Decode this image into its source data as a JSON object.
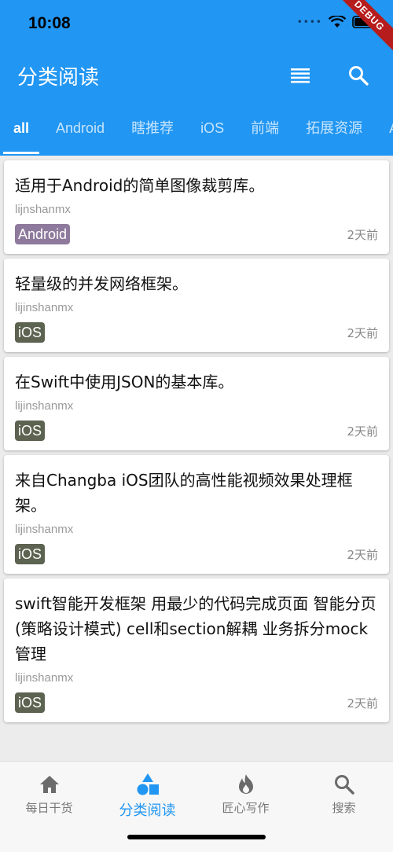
{
  "status_bar": {
    "time": "10:08",
    "debug_banner": "DEBUG"
  },
  "appbar": {
    "title": "分类阅读"
  },
  "tabs": [
    "all",
    "Android",
    "瞎推荐",
    "iOS",
    "前端",
    "拓展资源",
    "App"
  ],
  "active_tab": "all",
  "cards": [
    {
      "title": "适用于Android的简单图像裁剪库。",
      "author": "lijnshanmx",
      "tag": "Android",
      "tag_color": "#8e7a9c",
      "time": "2天前"
    },
    {
      "title": "轻量级的并发网络框架。",
      "author": "lijinshanmx",
      "tag": "iOS",
      "tag_color": "#5c6350",
      "time": "2天前"
    },
    {
      "title": "在Swift中使用JSON的基本库。",
      "author": "lijinshanmx",
      "tag": "iOS",
      "tag_color": "#5c6350",
      "time": "2天前"
    },
    {
      "title": "来自Changba iOS团队的高性能视频效果处理框架。",
      "author": "lijinshanmx",
      "tag": "iOS",
      "tag_color": "#5c6350",
      "time": "2天前"
    },
    {
      "title": "swift智能开发框架 用最少的代码完成页面 智能分页(策略设计模式) cell和section解耦 业务拆分mock管理",
      "author": "lijinshanmx",
      "tag": "iOS",
      "tag_color": "#5c6350",
      "time": "2天前"
    }
  ],
  "bottom_nav": [
    {
      "label": "每日干货",
      "icon": "home-icon"
    },
    {
      "label": "分类阅读",
      "icon": "category-icon"
    },
    {
      "label": "匠心写作",
      "icon": "flame-icon"
    },
    {
      "label": "搜索",
      "icon": "search-icon"
    }
  ],
  "active_nav": "分类阅读",
  "colors": {
    "primary": "#2196f3",
    "debug": "#b71c1c"
  }
}
